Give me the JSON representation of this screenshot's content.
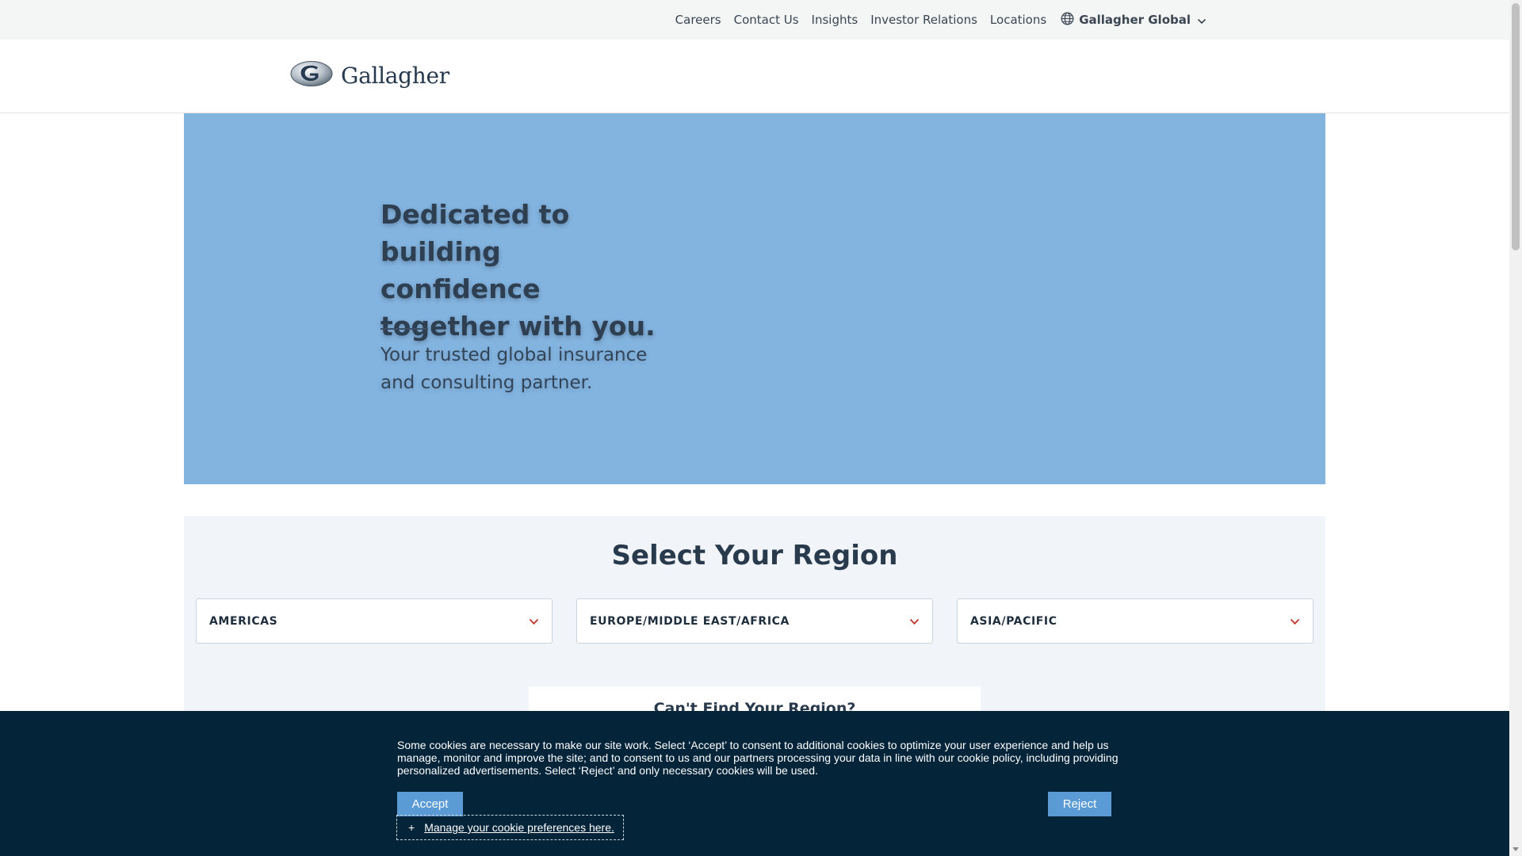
{
  "utility_nav": {
    "links": [
      "Careers",
      "Contact Us",
      "Insights",
      "Investor Relations",
      "Locations"
    ],
    "global_selector": {
      "label": "Gallagher Global",
      "icon": "globe-icon",
      "chevron": "chevron-down-icon"
    }
  },
  "header": {
    "logo_text": "Gallagher"
  },
  "hero": {
    "title": "Dedicated to building confidence together with you.",
    "subtitle": "Your trusted global insurance and consulting partner.",
    "background_color": "#83b3df"
  },
  "regions": {
    "heading_prefix": "Select",
    "heading_strong": "Your Region",
    "dropdowns": [
      "AMERICAS",
      "EUROPE/MIDDLE EAST/AFRICA",
      "ASIA/PACIFIC"
    ],
    "chevron_color": "#c0392b",
    "cant_find": "Can't Find Your Region?"
  },
  "cookie_banner": {
    "text": "Some cookies are necessary to make our site work. Select ‘Accept’ to consent to additional cookies to optimize your user experience and help us manage, monitor and improve the site; and to consent to us and our partners processing your data in line with our cookie policy, including providing personalized advertisements. Select ‘Reject’ and only necessary cookies will be used.",
    "accept_label": "Accept",
    "reject_label": "Reject",
    "manage_plus": "+",
    "manage_label": "Manage your cookie preferences here.",
    "background_color": "#04243a",
    "button_color": "#5b9bd5"
  }
}
